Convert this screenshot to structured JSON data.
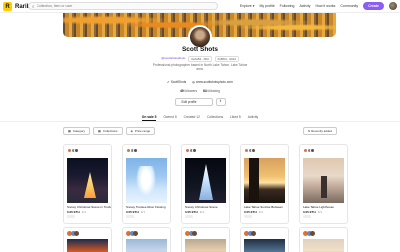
{
  "nav": {
    "logo_text": "Rarible",
    "search_placeholder": "Collection, item or user",
    "explore": "Explore",
    "links": [
      "My profile",
      "Following",
      "Activity",
      "How it works",
      "Community"
    ],
    "create": "Create"
  },
  "profile": {
    "name": "Scott Shots",
    "handle": "@scottshotsphoto",
    "address": "0x2a53...f3fd",
    "code": "0x8f64...3d1d",
    "bio": "Professional photographer based in North Lake Tahoe. Lake Tahoe area.",
    "twitter": "ScottShots",
    "website": "www.scottshotsphoto.com",
    "followers_count": "49",
    "followers_label": "followers",
    "following_count": "64",
    "following_label": "following",
    "edit_label": "Edit profile",
    "share_label": "⇪"
  },
  "tabs": [
    "On sale 5",
    "Owned 5",
    "Created 12",
    "Collections",
    "Liked 5",
    "Activity"
  ],
  "filters": {
    "category": "Category",
    "collections": "Collections",
    "price": "Price range",
    "sort": "Recently added"
  },
  "cards": [
    {
      "title": "Snowy Christmas Scene in Truckee",
      "price": "0.05 ETH",
      "edition": "1/1"
    },
    {
      "title": "Snowy Truckee River Flowing",
      "price": "0.05 ETH",
      "edition": "1/1"
    },
    {
      "title": "Snowy Christmas Scene",
      "price": "0.05 ETH",
      "edition": "1/1"
    },
    {
      "title": "Lake Tahoe Sunrise Between",
      "price": "0.05 ETH",
      "edition": "1/1"
    },
    {
      "title": "Lake Tahoe Lighthouse",
      "price": "0.05 ETH",
      "edition": "1/1"
    }
  ]
}
